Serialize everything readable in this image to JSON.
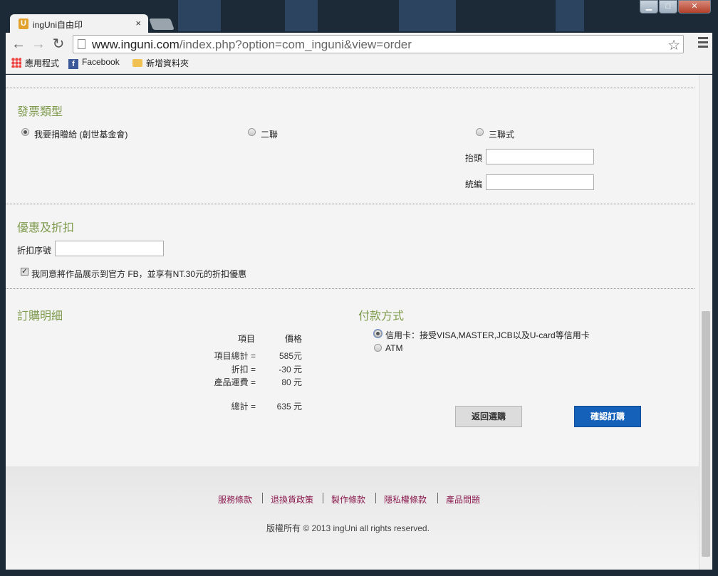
{
  "browser": {
    "tab_title": "ingUni自由印",
    "tab_favicon": "U",
    "tab_close": "×",
    "url_host": "www.inguni.com",
    "url_rest": "/index.php?option=com_inguni&view=order",
    "bookmarks": [
      {
        "label": "應用程式",
        "icon": "apps-icon"
      },
      {
        "label": "Facebook",
        "icon": "facebook-icon"
      },
      {
        "label": "新增資料夾",
        "icon": "folder-icon"
      }
    ],
    "window_buttons": {
      "minimize": "▁",
      "maximize": "□",
      "close": "✕"
    },
    "nav_icons": {
      "back": "←",
      "forward": "→",
      "reload": "↻",
      "star": "☆"
    }
  },
  "invoice": {
    "title": "發票類型",
    "options": [
      {
        "label": "我要捐贈給 (創世基金會)",
        "selected": true
      },
      {
        "label": "二聯",
        "selected": false
      },
      {
        "label": "三聯式",
        "selected": false
      }
    ],
    "header_label": "抬頭",
    "tax_id_label": "統編",
    "header_value": "",
    "tax_id_value": ""
  },
  "discount": {
    "title": "優惠及折扣",
    "code_label": "折扣序號",
    "code_value": "",
    "agree_text": "我同意將作品展示到官方 FB，並享有NT.30元的折扣優惠",
    "agree_checked": true
  },
  "order": {
    "title": "訂購明細",
    "col_item": "項目",
    "col_price": "價格",
    "rows": [
      {
        "label": "項目總計 =",
        "value": "585元"
      },
      {
        "label": "折扣 =",
        "value": "-30 元"
      },
      {
        "label": "產品運費 =",
        "value": "80 元"
      }
    ],
    "total_label": "總計 =",
    "total_value": "635 元"
  },
  "payment": {
    "title": "付款方式",
    "options": [
      {
        "label": "信用卡：接受VISA,MASTER,JCB以及U-card等信用卡",
        "selected": true
      },
      {
        "label": "ATM",
        "selected": false
      }
    ]
  },
  "buttons": {
    "back": "返回選購",
    "confirm": "確認訂購"
  },
  "footer": {
    "links": [
      "服務條款",
      "退換貨政策",
      "製作條款",
      "隱私權條款",
      "產品問題"
    ],
    "copyright": "版權所有 © 2013  ingUni  all rights reserved."
  },
  "colors": {
    "section_title": "#7f9b4e",
    "confirm_button": "#1560b8",
    "footer_link": "#8a1a4e"
  }
}
